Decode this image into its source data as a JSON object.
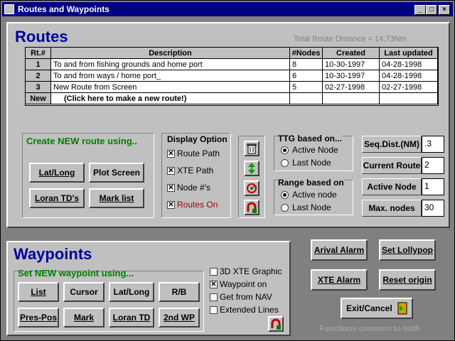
{
  "window": {
    "title": "Routes and Waypoints"
  },
  "routes": {
    "heading": "Routes",
    "total_distance": "Total Route Distance = 14.73Nm",
    "columns": [
      "Rt.#",
      "Description",
      "#Nodes",
      "Created",
      "Last updated"
    ],
    "rows": [
      {
        "num": "1",
        "desc": "To and from fishing grounds and home port",
        "nodes": "8",
        "created": "10-30-1997",
        "updated": "04-28-1998"
      },
      {
        "num": "2",
        "desc": "To and from ways / home port_",
        "nodes": "6",
        "created": "10-30-1997",
        "updated": "04-28-1998"
      },
      {
        "num": "3",
        "desc": "New Route from Screen",
        "nodes": "5",
        "created": "02-27-1998",
        "updated": "02-27-1998"
      },
      {
        "num": "New",
        "desc": "(Click here to make a new route!)",
        "nodes": "",
        "created": "",
        "updated": ""
      }
    ],
    "create_label": "Create NEW route using..",
    "create_buttons": [
      "Lat/Long",
      "Plot Screen",
      "Loran TD's",
      "Mark list"
    ],
    "display_option": {
      "label": "Display Option",
      "items": [
        {
          "label": "Route Path",
          "checked": true
        },
        {
          "label": "XTE Path",
          "checked": true
        },
        {
          "label": "Node #'s",
          "checked": true
        },
        {
          "label": "Routes On",
          "checked": true
        }
      ]
    },
    "ttg": {
      "label": "TTG based on...",
      "options": [
        "Active Node",
        "Last Node"
      ],
      "selected": 0
    },
    "range": {
      "label": "Range based on",
      "options": [
        "Active node",
        "Last Node"
      ],
      "selected": 0
    },
    "fields": [
      {
        "label": "Seq.Dist.(NM)",
        "value": ".3"
      },
      {
        "label": "Current Route",
        "value": "2"
      },
      {
        "label": "Active Node",
        "value": "1"
      },
      {
        "label": "Max. nodes",
        "value": "30"
      }
    ]
  },
  "waypoints": {
    "heading": "Waypoints",
    "set_label": "Set NEW waypoint using...",
    "buttons": [
      "List",
      "Cursor",
      "Lat/Long",
      "R/B",
      "Pres-Pos",
      "Mark",
      "Loran TD",
      "2nd WP"
    ],
    "checks": [
      {
        "label": "3D XTE Graphic",
        "checked": false
      },
      {
        "label": "Waypoint on",
        "checked": true
      },
      {
        "label": "Get from NAV",
        "checked": false
      },
      {
        "label": "Extended Lines",
        "checked": false
      }
    ]
  },
  "common": {
    "buttons": [
      "Arival Alarm",
      "Set Lollypop",
      "XTE Alarm",
      "Reset origin"
    ],
    "exit": "Exit/Cancel",
    "note": "Functions common to both"
  },
  "colors": {
    "title_bar": "#000080",
    "heading": "#0000a0",
    "create_label": "#008000",
    "routes_on": "#a00000",
    "panel": "#c0c0c0"
  }
}
